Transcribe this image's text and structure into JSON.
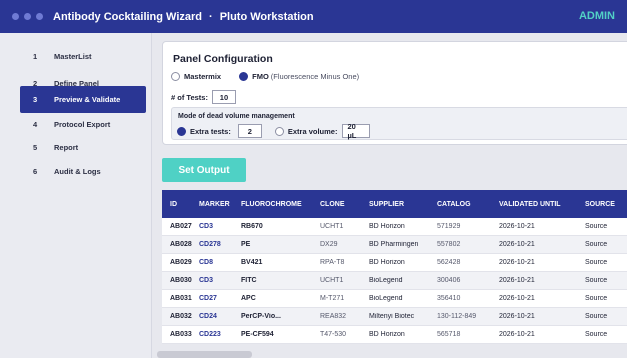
{
  "window": {
    "app_title": "Antibody Cocktailing Wizard",
    "separator": "·",
    "workstation": "Pluto Workstation",
    "user": "ADMIN",
    "dots": [
      "#5f6cc7",
      "#5f6cc7",
      "#5f6cc7"
    ]
  },
  "sidebar": {
    "items": [
      {
        "num": "1",
        "label": "MasterList",
        "active": false
      },
      {
        "num": "2",
        "label": "Define Panel",
        "active": false
      },
      {
        "num": "3",
        "label": "Preview & Validate",
        "active": true
      },
      {
        "num": "4",
        "label": "Protocol Export",
        "active": false
      },
      {
        "num": "5",
        "label": "Report",
        "active": false
      },
      {
        "num": "6",
        "label": "Audit & Logs",
        "active": false
      }
    ]
  },
  "panel": {
    "title": "Panel Configuration",
    "mode_options": [
      {
        "label": "Mastermix",
        "selected": false
      },
      {
        "label": "FMO",
        "sub": "(Fluorescence Minus One)",
        "selected": true
      }
    ],
    "tests_label": "# of Tests:",
    "tests_value": "10",
    "dead_volume": {
      "title": "Mode of dead volume management",
      "extra_tests_label": "Extra tests:",
      "extra_tests_value": "2",
      "extra_tests_selected": true,
      "extra_volume_label": "Extra volume:",
      "extra_volume_value": "20 µL",
      "extra_volume_selected": false
    }
  },
  "actions": {
    "set_output": "Set Output"
  },
  "table": {
    "headers": [
      "ID",
      "MARKER",
      "FLUOROCHROME",
      "CLONE",
      "SUPPLIER",
      "CATALOG",
      "VALIDATED UNTIL",
      "SOURCE"
    ],
    "rows": [
      [
        "AB027",
        "CD3",
        "RB670",
        "UCHT1",
        "BD Horizon",
        "571929",
        "2026-10-21",
        "Source"
      ],
      [
        "AB028",
        "CD278",
        "PE",
        "DX29",
        "BD Pharmingen",
        "557802",
        "2026-10-21",
        "Source"
      ],
      [
        "AB029",
        "CD8",
        "BV421",
        "RPA-T8",
        "BD Horizon",
        "562428",
        "2026-10-21",
        "Source"
      ],
      [
        "AB030",
        "CD3",
        "FITC",
        "UCHT1",
        "BioLegend",
        "300406",
        "2026-10-21",
        "Source"
      ],
      [
        "AB031",
        "CD27",
        "APC",
        "M-T271",
        "BioLegend",
        "356410",
        "2026-10-21",
        "Source"
      ],
      [
        "AB032",
        "CD24",
        "PerCP-Vio...",
        "REA832",
        "Miltenyi Biotec",
        "130-112-849",
        "2026-10-21",
        "Source"
      ],
      [
        "AB033",
        "CD223",
        "PE-CF594",
        "T47-530",
        "BD Horizon",
        "565718",
        "2026-10-21",
        "Source"
      ]
    ]
  }
}
